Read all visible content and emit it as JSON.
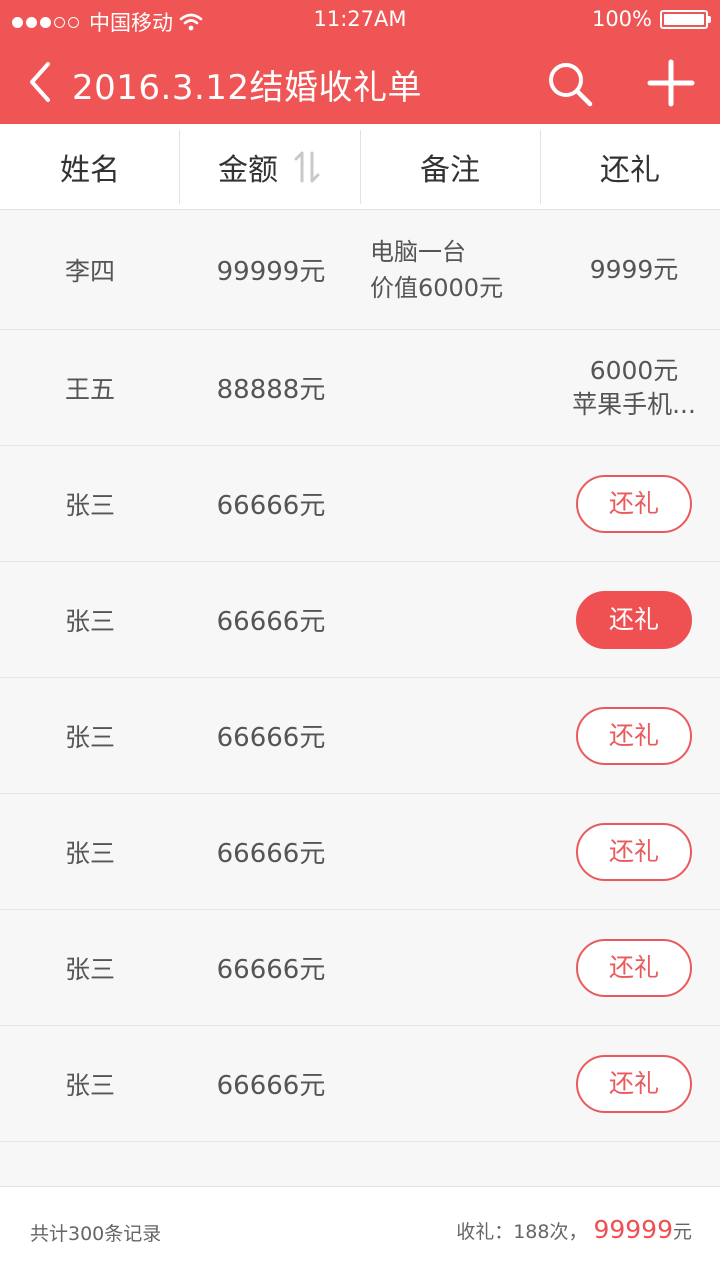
{
  "status_bar": {
    "carrier": "中国移动",
    "time": "11:27AM",
    "battery": "100%"
  },
  "app_bar": {
    "title": "2016.3.12结婚收礼单",
    "back_icon": "chevron-left-icon",
    "search_icon": "search-icon",
    "add_icon": "plus-icon"
  },
  "columns": {
    "name": "姓名",
    "amount": "金额",
    "note": "备注",
    "return": "还礼"
  },
  "rows": [
    {
      "name": "李四",
      "amount": "99999元",
      "note1": "电脑一台",
      "note2": "价值6000元",
      "ret1": "9999元",
      "ret2": "",
      "btn": ""
    },
    {
      "name": "王五",
      "amount": "88888元",
      "note1": "",
      "note2": "",
      "ret1": "6000元",
      "ret2": "苹果手机...",
      "btn": ""
    },
    {
      "name": "张三",
      "amount": "66666元",
      "note1": "",
      "note2": "",
      "ret1": "",
      "ret2": "",
      "btn": "还礼"
    },
    {
      "name": "张三",
      "amount": "66666元",
      "note1": "",
      "note2": "",
      "ret1": "",
      "ret2": "",
      "btn": "还礼"
    },
    {
      "name": "张三",
      "amount": "66666元",
      "note1": "",
      "note2": "",
      "ret1": "",
      "ret2": "",
      "btn": "还礼"
    },
    {
      "name": "张三",
      "amount": "66666元",
      "note1": "",
      "note2": "",
      "ret1": "",
      "ret2": "",
      "btn": "还礼"
    },
    {
      "name": "张三",
      "amount": "66666元",
      "note1": "",
      "note2": "",
      "ret1": "",
      "ret2": "",
      "btn": "还礼"
    },
    {
      "name": "张三",
      "amount": "66666元",
      "note1": "",
      "note2": "",
      "ret1": "",
      "ret2": "",
      "btn": "还礼"
    }
  ],
  "footer": {
    "total_records": "共计300条记录",
    "received_label": "收礼：188次，",
    "received_amount": "99999",
    "received_unit": "元"
  },
  "colors": {
    "accent": "#f05556",
    "button_red": "#ea5a5c"
  }
}
